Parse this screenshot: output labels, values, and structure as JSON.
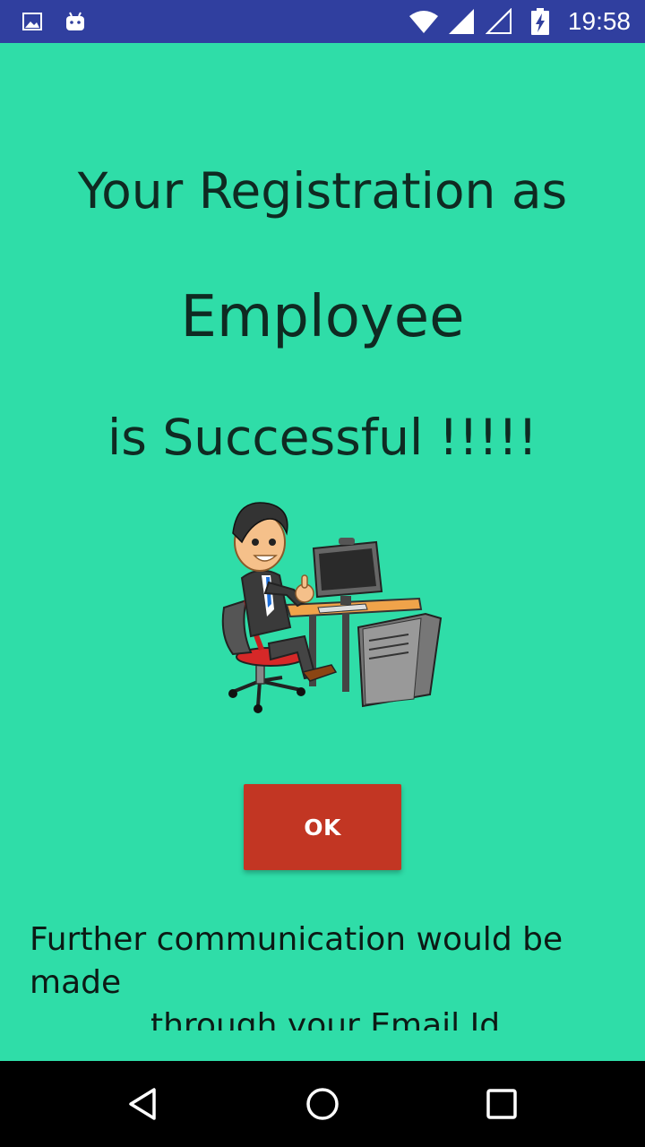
{
  "status_bar": {
    "time": "19:58",
    "icons": [
      "gallery-notification-icon",
      "android-notification-icon",
      "wifi-icon",
      "cell-signal-icon",
      "cell-signal-empty-icon",
      "battery-charging-icon"
    ],
    "background_color": "#303F9F"
  },
  "main": {
    "background_color": "#2FDDA8",
    "headline_line1": "Your Registration as",
    "headline_line2": "Employee",
    "headline_line3": "is Successful !!!!!",
    "illustration_icon": "employee-at-computer-illustration",
    "ok_button_label": "OK",
    "ok_button_color": "#C23623",
    "message_line1": "Further communication would be",
    "message_line2": "made",
    "message_line3": "through your Email Id"
  },
  "nav_bar": {
    "icons": [
      "back-icon",
      "home-icon",
      "recents-icon"
    ]
  }
}
